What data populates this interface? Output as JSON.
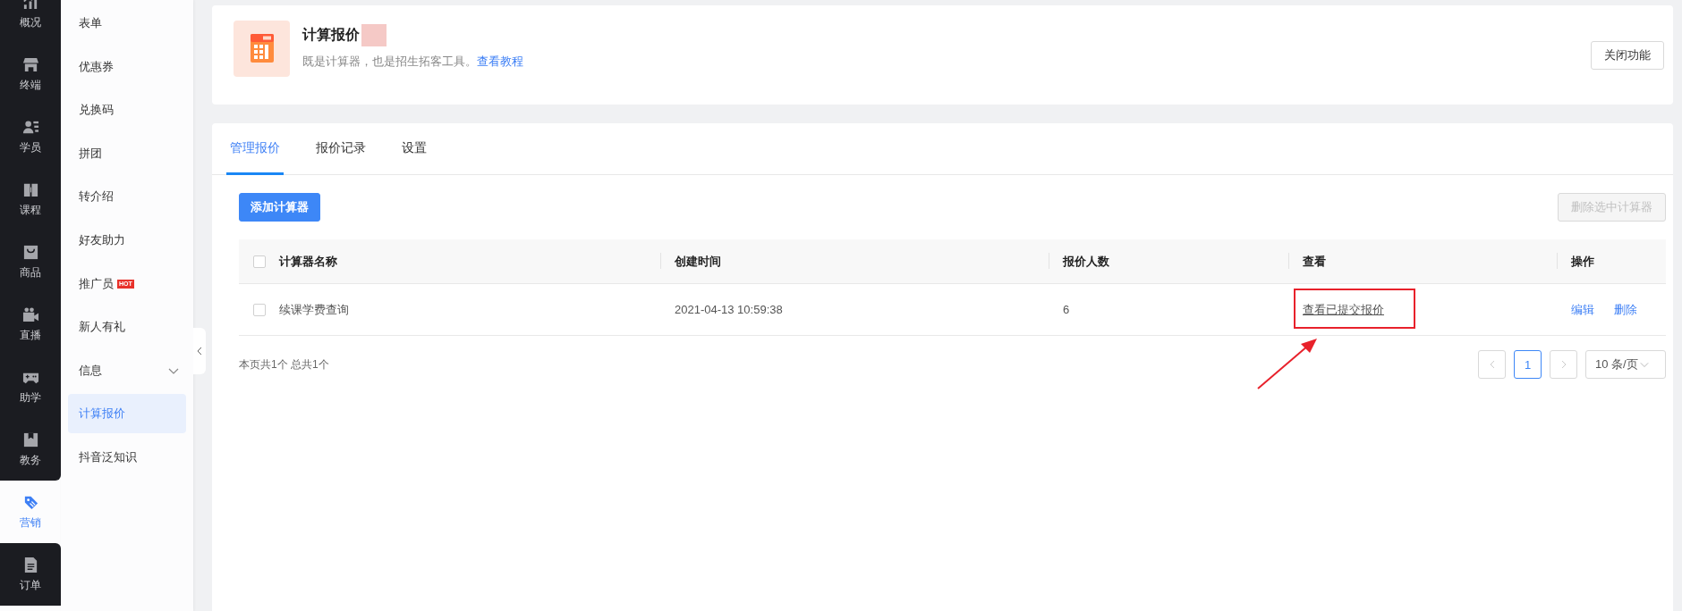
{
  "icon_rail": [
    {
      "label": "概况",
      "selected": false
    },
    {
      "label": "终端",
      "selected": false
    },
    {
      "label": "学员",
      "selected": false
    },
    {
      "label": "课程",
      "selected": false
    },
    {
      "label": "商品",
      "selected": false
    },
    {
      "label": "直播",
      "selected": false
    },
    {
      "label": "助学",
      "selected": false
    },
    {
      "label": "教务",
      "selected": false
    },
    {
      "label": "营销",
      "selected": true
    },
    {
      "label": "订单",
      "selected": false
    }
  ],
  "sub_nav": [
    {
      "label": "表单",
      "kind": "link",
      "selected": false
    },
    {
      "label": "优惠券",
      "kind": "link",
      "selected": false
    },
    {
      "label": "兑换码",
      "kind": "link",
      "selected": false
    },
    {
      "label": "拼团",
      "kind": "link",
      "selected": false
    },
    {
      "label": "转介绍",
      "kind": "link",
      "selected": false
    },
    {
      "label": "好友助力",
      "kind": "link",
      "selected": false
    },
    {
      "label": "推广员",
      "kind": "link",
      "selected": false,
      "badge": "HOT"
    },
    {
      "label": "新人有礼",
      "kind": "link",
      "selected": false
    },
    {
      "label": "信息",
      "kind": "group",
      "selected": false,
      "expanded": false
    },
    {
      "label": "计算报价",
      "kind": "link",
      "selected": true
    },
    {
      "label": "抖音泛知识",
      "kind": "link",
      "selected": false
    }
  ],
  "feature": {
    "title": "计算报价",
    "subtitle": "既是计算器，也是招生拓客工具。",
    "link": "查看教程",
    "close_button": "关闭功能"
  },
  "tabs": [
    {
      "label": "管理报价",
      "selected": true
    },
    {
      "label": "报价记录",
      "selected": false
    },
    {
      "label": "设置",
      "selected": false
    }
  ],
  "toolbar": {
    "add_button": "添加计算器",
    "delete_button": {
      "label": "删除选中计算器",
      "disabled": true
    }
  },
  "table": {
    "select_all_checked": false,
    "columns": [
      "计算器名称",
      "创建时间",
      "报价人数",
      "查看",
      "操作"
    ],
    "rows": [
      {
        "checked": false,
        "name": "续课学费查询",
        "created": "2021-04-13 10:59:38",
        "count": "6",
        "view_link": "查看已提交报价",
        "actions": [
          "编辑",
          "删除"
        ]
      }
    ]
  },
  "footer": {
    "summary": "本页共1个 总共1个"
  },
  "pagination": {
    "prev_disabled": true,
    "next_disabled": true,
    "pages": [
      {
        "label": "1",
        "selected": true
      }
    ],
    "page_size": "10 条/页"
  }
}
